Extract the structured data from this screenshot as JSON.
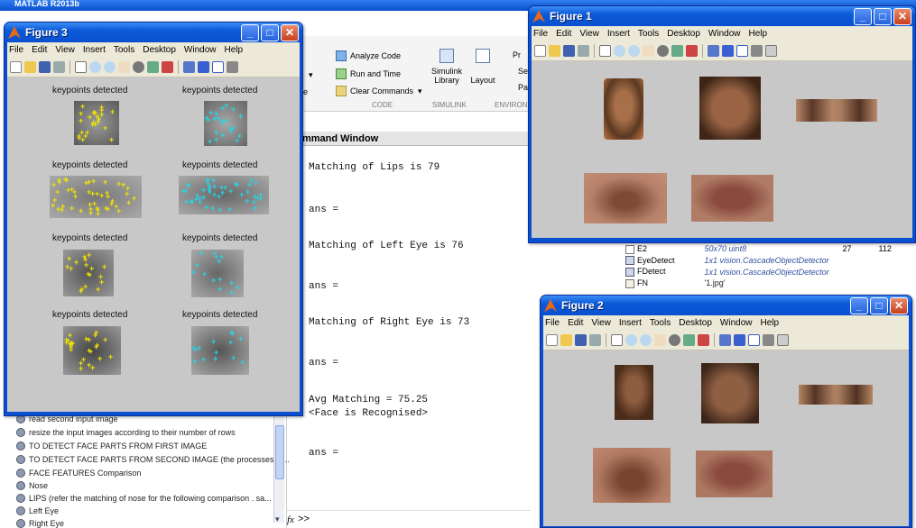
{
  "matlab": {
    "title": "MATLAB R2013b",
    "ribbon": {
      "analyze_code": "Analyze Code",
      "run_and_time": "Run and Time",
      "clear_commands": "Clear Commands",
      "code_section": "CODE",
      "simulink_library": "Simulink Library",
      "simulink_section": "SIMULINK",
      "layout": "Layout",
      "environment_section": "ENVIRON",
      "prefs_short": "Pr",
      "set_short": "Se",
      "pa_short": "Pa",
      "e_short": "e"
    },
    "command_window": {
      "header": "mmand Window",
      "lines": [
        "Matching of Lips is 79",
        "ans =",
        "Matching of Left Eye is 76",
        "ans =",
        "Matching of Right Eye is 73",
        "ans =",
        "Avg Matching = 75.25",
        "<Face is Recognised>",
        "ans ="
      ],
      "prompt": ">>",
      "fx": "fx"
    },
    "history": [
      "read second input image",
      "resize the input images according to their number of rows",
      "TO DETECT FACE PARTS FROM FIRST IMAGE",
      "TO DETECT FACE PARTS FROM SECOND IMAGE (the processes ar...",
      "FACE FEATURES Comparison",
      "Nose",
      "LIPS (refer the matching of nose  for the following comparison . sa...",
      "Left Eye",
      "Right Eye"
    ],
    "workspace": [
      {
        "name": "E2",
        "value": "50x70 uint8",
        "min": "27",
        "max": "112"
      },
      {
        "name": "EyeDetect",
        "value": "1x1 vision.CascadeObjectDetector",
        "min": "",
        "max": ""
      },
      {
        "name": "FDetect",
        "value": "1x1 vision.CascadeObjectDetector",
        "min": "",
        "max": ""
      },
      {
        "name": "FN",
        "value": "'1.jpg'",
        "min": "",
        "max": ""
      }
    ]
  },
  "figure_menu": [
    "File",
    "Edit",
    "View",
    "Insert",
    "Tools",
    "Desktop",
    "Window",
    "Help"
  ],
  "figure3": {
    "title": "Figure 3",
    "keypoint_label": "keypoints detected"
  },
  "figure1": {
    "title": "Figure 1"
  },
  "figure2": {
    "title": "Figure 2"
  },
  "colors": {
    "title_bar": "#0a5ad8",
    "figure_bg": "#c8c8c8",
    "keypoints_yellow": "#f2e600",
    "keypoints_cyan": "#22d8e8"
  }
}
